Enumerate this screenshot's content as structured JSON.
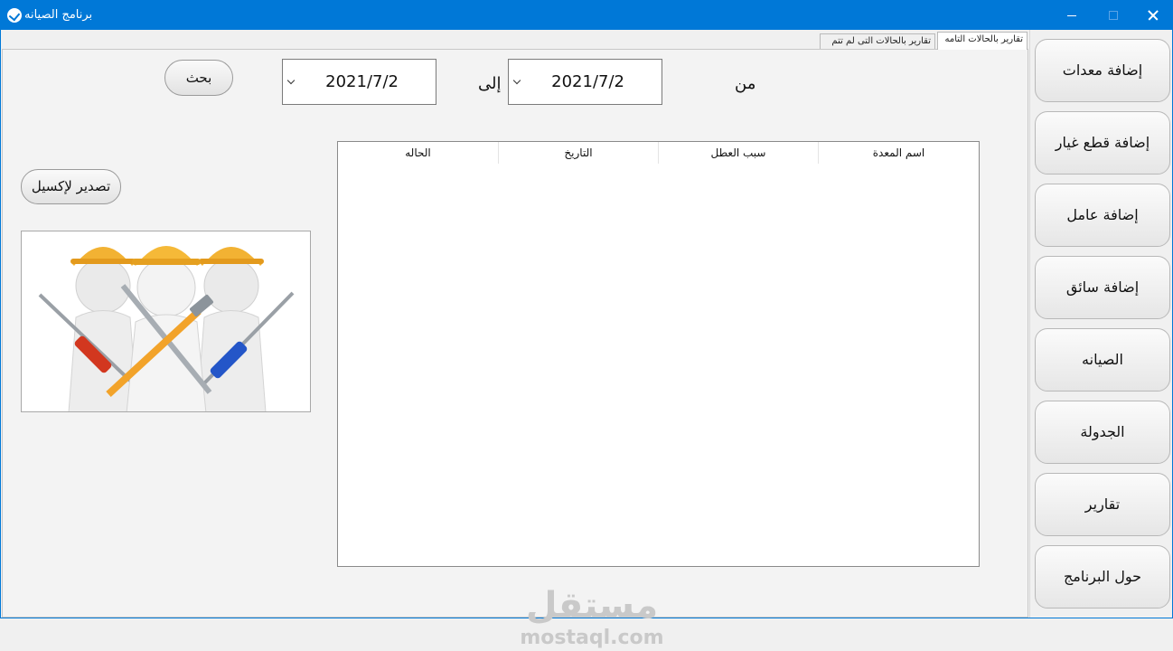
{
  "window": {
    "title": "برنامج الصيانه",
    "controls": {
      "minimize": "minimize-icon",
      "maximize": "maximize-icon",
      "close": "close-icon"
    },
    "accent_color": "#0078d7"
  },
  "sidebar": {
    "items": [
      {
        "label": "إضافة معدات"
      },
      {
        "label": "إضافة قطع غيار"
      },
      {
        "label": "إضافة عامل"
      },
      {
        "label": "إضافة سائق"
      },
      {
        "label": "الصيانه"
      },
      {
        "label": "الجدولة"
      },
      {
        "label": "تقارير"
      },
      {
        "label": "حول البرنامج"
      }
    ]
  },
  "tabs": [
    {
      "label": "تقارير بالحالات التامه",
      "active": true
    },
    {
      "label": "تقارير بالحالات التى لم تتم",
      "active": false
    }
  ],
  "filter": {
    "from_label": "من",
    "from_date": "2021/7/2",
    "to_label": "إلى",
    "to_date": "2021/7/2",
    "search_button": "بحث"
  },
  "export_button": "تصدير لإكسيل",
  "table": {
    "columns": [
      "اسم المعدة",
      "سبب العطل",
      "التاريخ",
      "الحاله"
    ],
    "rows": []
  },
  "image": {
    "alt_icon": "workers-with-tools-illustration"
  },
  "watermark": {
    "arabic": "مستقل",
    "latin": "mostaql.com"
  }
}
